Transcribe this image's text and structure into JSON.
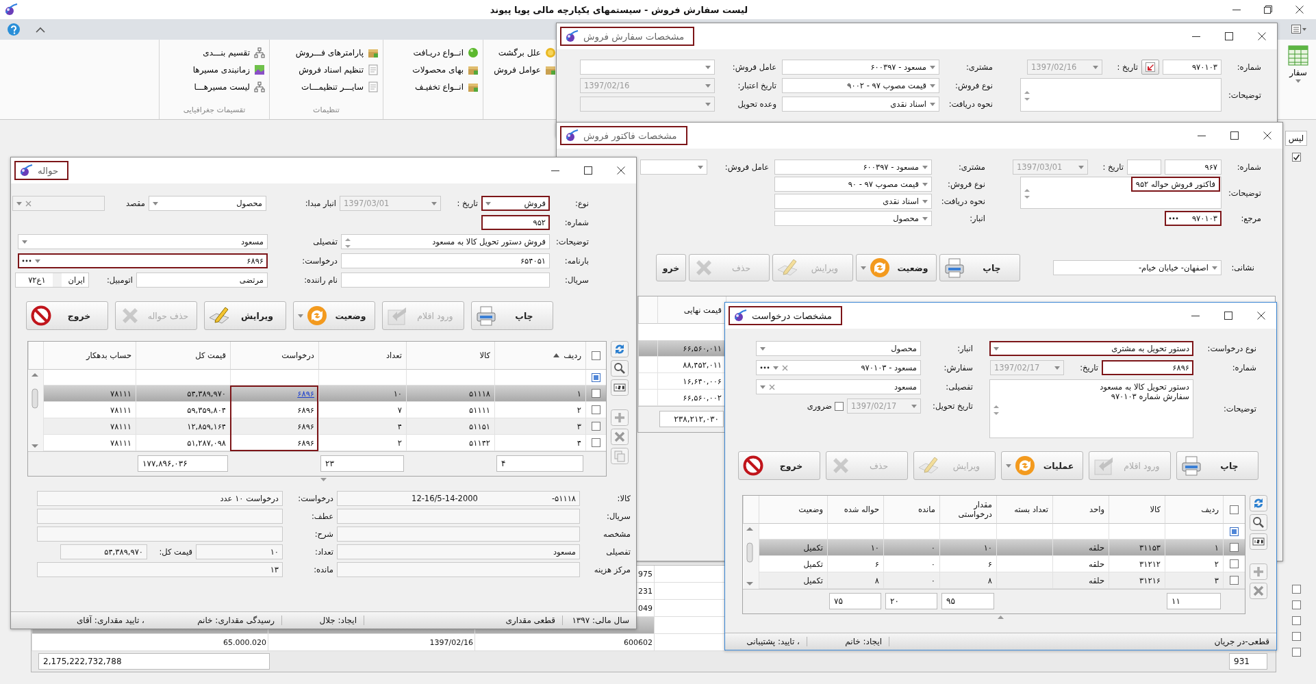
{
  "main": {
    "title": "لیست سفارش فروش - سیستمهای یکپارچه مالی پویا پیوند",
    "ribbon_button": "سفار",
    "ribbon_groups": [
      {
        "items": [
          {
            "label": "علل برگشت"
          },
          {
            "label": "عوامل فروش"
          }
        ]
      },
      {
        "items": [
          {
            "label": "انــواع دریـافت"
          },
          {
            "label": "بهای محصولات"
          },
          {
            "label": "انــواع تخفیـف"
          }
        ]
      },
      {
        "caption": "تنظیمات",
        "items": [
          {
            "label": "پارامترهای فـــروش"
          },
          {
            "label": "تنظیم اسناد فروش"
          },
          {
            "label": "سایـــر تنظیمـــات"
          }
        ]
      },
      {
        "caption": "تقسیمات جغرافیایی",
        "items": [
          {
            "label": "تقسیم بنـــدی"
          },
          {
            "label": "زمانبندی مسیرها"
          },
          {
            "label": "لیست مسیرهـــا"
          }
        ]
      }
    ],
    "tabs": [
      {
        "label": "لیس",
        "selected": true
      }
    ],
    "checks": [
      {
        "checked": true
      },
      {
        "checked": false
      },
      {
        "checked": false
      },
      {
        "checked": false
      },
      {
        "checked": false
      },
      {
        "checked": false
      }
    ],
    "list": {
      "rows": [
        {
          "selected": false,
          "cells": [
            "975",
            null,
            null
          ]
        },
        {
          "selected": false,
          "cells": [
            "231",
            null,
            null
          ]
        },
        {
          "selected": false,
          "cells": [
            "049",
            null,
            null
          ]
        },
        {
          "selected": true,
          "cells": [
            null,
            null,
            null
          ]
        },
        {
          "selected": false,
          "cells": [
            "600602",
            "1397/02/16",
            "65.000.020"
          ]
        }
      ],
      "total": "2,175,222,732,788",
      "count": "931"
    }
  },
  "order": {
    "title": "مشخصات سفارش فروش",
    "title_highlighted": true,
    "form_columns": [
      [
        [
          {
            "label": "شماره:",
            "value": "۹۷۰۱۰۳",
            "kind": "text",
            "disabled": false
          },
          {
            "kind": "button"
          },
          {
            "label": "تاریخ :",
            "value": "1397/02/16",
            "kind": "date",
            "disabled": true
          }
        ],
        [
          {
            "label": "توضیحات:",
            "kind": "memo",
            "disabled": false
          }
        ]
      ],
      [
        [
          {
            "label": "مشتری:",
            "value": "مسعود - ۶۰۰۳۹۷",
            "kind": "combo",
            "disabled": false
          }
        ],
        [
          {
            "label": "نوع فروش:",
            "value": "قیمت مصوب ۹۷ - ۹۰۰۲",
            "kind": "combo",
            "disabled": false
          }
        ],
        [
          {
            "label": "نحوه دریافت:",
            "value": "اسناد نقدی",
            "kind": "combo",
            "disabled": false
          }
        ]
      ],
      [
        [
          {
            "label": "عامل فروش:",
            "kind": "combo",
            "disabled": false
          }
        ],
        [
          {
            "label": "تاریخ اعتبار:",
            "value": "1397/02/16",
            "kind": "date",
            "disabled": true
          }
        ],
        [
          {
            "label": "وعده تحویل",
            "kind": "combo",
            "disabled": true
          }
        ]
      ]
    ]
  },
  "invoice": {
    "title": "مشخصات فاکتور فروش",
    "title_highlighted": true,
    "form_columns": [
      [
        [
          {
            "label": "شماره:",
            "value": "۹۶۷",
            "kind": "text",
            "disabled": false
          },
          {
            "kind": "text",
            "disabled": false
          },
          {
            "label": "تاریخ :",
            "value": "1397/03/01",
            "kind": "date",
            "disabled": true
          }
        ],
        [
          {
            "label": "توضیحات:",
            "value": "فاکتور فروش حواله ۹۵۲",
            "kind": "memo",
            "highlighted": true,
            "disabled": false
          }
        ],
        [
          {
            "label": "مرجع:",
            "value": "۹۷۰۱۰۳",
            "kind": "text",
            "lookup": true,
            "highlighted": true,
            "disabled": false
          }
        ]
      ],
      [
        [
          {
            "label": "مشتری:",
            "value": "مسعود - ۶۰۰۳۹۷",
            "kind": "combo",
            "disabled": false
          }
        ],
        [
          {
            "label": "نوع فروش:",
            "value": "قیمت مصوب ۹۷ - ۹۰",
            "kind": "combo",
            "disabled": false
          }
        ],
        [
          {
            "label": "نحوه دریافت:",
            "value": "اسناد نقدی",
            "kind": "combo",
            "disabled": false
          }
        ],
        [
          {
            "label": "انبار:",
            "value": "محصول",
            "kind": "combo",
            "disabled": false
          }
        ]
      ],
      [
        [
          {
            "label": "عامل فروش:",
            "kind": "combo",
            "disabled": false
          }
        ]
      ]
    ],
    "address": {
      "label": "نشانی:",
      "value": "اصفهان- خیابان خیام-",
      "kind": "combo",
      "disabled": false
    },
    "buttons": [
      {
        "label": "چاپ",
        "kind": "print",
        "disabled": false
      },
      {
        "label": "وضعیت",
        "kind": "status",
        "menu": true,
        "disabled": false
      },
      {
        "label": "ویرایش",
        "kind": "edit",
        "disabled": true
      },
      {
        "label": "حذف",
        "kind": "delete",
        "disabled": true
      },
      {
        "label": "خرو",
        "kind": "exit",
        "disabled": false
      }
    ],
    "grid": {
      "columns": [
        {
          "label": "قیمت نهایی"
        }
      ],
      "totals": [
        "۲۳۸,۲۱۲,۰۳۰"
      ],
      "rows": [
        {
          "selected": true,
          "cells": [
            "۶۶,۵۶۰,۰۱۱"
          ]
        },
        {
          "selected": false,
          "cells": [
            "۸۸,۴۵۲,۰۱۱"
          ]
        },
        {
          "selected": false,
          "cells": [
            "۱۶,۶۴۰,۰۰۶"
          ]
        },
        {
          "selected": false,
          "cells": [
            "۶۶,۵۶۰,۰۰۲"
          ]
        }
      ]
    }
  },
  "transfer": {
    "title": "حواله",
    "title_highlighted": true,
    "form_rows": [
      [
        {
          "label": "نوع:",
          "value": "فروش",
          "kind": "combo",
          "highlighted": true,
          "disabled": false
        },
        {
          "label": "تاریخ :",
          "value": "1397/03/01",
          "kind": "date",
          "disabled": true
        },
        {
          "label": "انبار مبدا:",
          "value": "محصول",
          "kind": "combo",
          "disabled": false
        },
        {
          "label": "مقصد",
          "kind": "combo-clear",
          "disabled": true
        }
      ],
      [
        {
          "label": "شماره:",
          "value": "۹۵۲",
          "kind": "text",
          "highlighted": true,
          "disabled": false
        }
      ],
      [
        {
          "label": "توضیحات:",
          "value": "فروش دستور تحویل کالا به مسعود",
          "kind": "memo",
          "disabled": false
        },
        {
          "label": "تفصیلی",
          "value": "مسعود",
          "kind": "combo",
          "disabled": false
        }
      ],
      [
        {
          "label": "بارنامه:",
          "value": "۶۵۴۰۵۱",
          "kind": "text",
          "disabled": false
        },
        {
          "label": "درخواست:",
          "value": "۶۸۹۶",
          "kind": "combo",
          "lookup": true,
          "highlighted": true,
          "disabled": false
        }
      ],
      [
        {
          "label": "سریال:",
          "kind": "text",
          "disabled": false
        },
        {
          "label": "نام راننده:",
          "value": "مرتضی",
          "kind": "text",
          "disabled": false
        },
        {
          "label": "اتومبیل:",
          "kind": "plate",
          "region": "ایران",
          "value": "۱ع۷۲",
          "disabled": false
        }
      ]
    ],
    "buttons": [
      {
        "label": "چاپ",
        "kind": "print",
        "disabled": false
      },
      {
        "label": "ورود اقلام",
        "kind": "import",
        "disabled": true
      },
      {
        "label": "وضعیت",
        "kind": "status",
        "menu": true,
        "disabled": false
      },
      {
        "label": "ویرایش",
        "kind": "edit",
        "disabled": false
      },
      {
        "label": "حذف حواله",
        "kind": "delete",
        "disabled": true
      },
      {
        "label": "خروج",
        "kind": "exit",
        "disabled": false
      }
    ],
    "grid": {
      "header_checked": false,
      "columns": [
        {
          "label": "ردیف",
          "sorted": true,
          "highlighted": false
        },
        {
          "label": "کالا",
          "highlighted": false
        },
        {
          "label": "تعداد",
          "highlighted": false
        },
        {
          "label": "درخواست",
          "kind": "link",
          "highlighted": true
        },
        {
          "label": "قیمت کل",
          "highlighted": false
        },
        {
          "label": "حساب بدهکار",
          "highlighted": false
        }
      ],
      "totals": [
        "۴",
        "۲۳",
        "۱۷۷,۸۹۶,۰۳۶"
      ],
      "rows": [
        {
          "selected": true,
          "checked": false,
          "cells": [
            "۱",
            "۵۱۱۱۸",
            "۱۰",
            "۶۸۹۶",
            "۵۴,۳۸۹,۹۷۰",
            "۷۸۱۱۱"
          ]
        },
        {
          "selected": false,
          "checked": false,
          "cells": [
            "۲",
            "۵۱۱۱۱",
            "۷",
            "۶۸۹۶",
            "۵۹,۳۵۹,۸۰۴",
            "۷۸۱۱۱"
          ]
        },
        {
          "selected": false,
          "checked": false,
          "cells": [
            "۳",
            "۵۱۱۵۱",
            "۴",
            "۶۸۹۶",
            "۱۲,۸۵۹,۱۶۴",
            "۷۸۱۱۱"
          ]
        },
        {
          "selected": false,
          "checked": false,
          "cells": [
            "۴",
            "۵۱۱۴۲",
            "۲",
            "۶۸۹۶",
            "۵۱,۲۸۷,۰۹۸",
            "۷۸۱۱۱"
          ]
        }
      ]
    },
    "detail_rows": [
      [
        {
          "label": "کالا:",
          "value": "۵۱۱۱۸-",
          "description": "12-16/5-14-2000",
          "kind": "text"
        },
        {
          "label": "درخواست:",
          "value": "درخواست ۱۰ عدد",
          "kind": "text"
        }
      ],
      [
        {
          "label": "سریال:",
          "kind": "text"
        },
        {
          "label": "عطف:",
          "kind": "text"
        }
      ],
      [
        {
          "label": "مشخصه",
          "kind": "text"
        },
        {
          "label": "شرح:",
          "kind": "text"
        }
      ],
      [
        {
          "label": "تفصیلی",
          "value": "مسعود",
          "kind": "text"
        },
        {
          "label": "تعداد:",
          "value": "۱۰",
          "kind": "text"
        },
        {
          "label": "قیمت کل:",
          "value": "۵۴,۳۸۹,۹۷۰",
          "kind": "text"
        }
      ],
      [
        {
          "label": "مرکز هزینه",
          "kind": "text"
        },
        {
          "label": "مانده:",
          "value": "۱۳",
          "kind": "text"
        }
      ]
    ],
    "status": [
      "سال مالی: ۱۳۹۷",
      "قطعی مقداری",
      "ایجاد: جلال",
      "رسیدگی مقداری: خانم",
      "، تایید مقداری: آقای"
    ]
  },
  "request": {
    "title": "مشخصات درخواست",
    "title_highlighted": true,
    "form_columns": [
      [
        [
          {
            "label": "نوع درخواست:",
            "value": "دستور تحویل به مشتری",
            "kind": "combo",
            "highlighted": true,
            "disabled": false
          }
        ],
        [
          {
            "label": "شماره:",
            "value": "۶۸۹۶",
            "kind": "text",
            "highlighted": true,
            "disabled": false
          },
          {
            "label": "تاریخ:",
            "value": "1397/02/17",
            "kind": "date",
            "disabled": true
          }
        ],
        [
          {
            "label": "توضیحات:",
            "lines": [
              "دستور تحویل کالا به مسعود",
              "سفارش شماره ۹۷۰۱۰۳"
            ],
            "kind": "memo",
            "disabled": false
          }
        ]
      ],
      [
        [
          {
            "label": "انبار:",
            "value": "محصول",
            "kind": "combo",
            "disabled": false
          }
        ],
        [
          {
            "label": "سفارش:",
            "value": "مسعود - ۹۷۰۱۰۳",
            "kind": "combo-clear",
            "lookup": true,
            "disabled": false
          }
        ],
        [
          {
            "label": "تفصیلی:",
            "value": "مسعود",
            "kind": "combo-clear",
            "disabled": false
          }
        ],
        [
          {
            "label": "تاریخ تحویل:",
            "value": "1397/02/17",
            "kind": "date",
            "disabled": true
          },
          {
            "label": "ضروری",
            "kind": "checkbox",
            "checked": false
          }
        ]
      ]
    ],
    "buttons": [
      {
        "label": "چاپ",
        "kind": "print",
        "disabled": false
      },
      {
        "label": "ورود اقلام",
        "kind": "import",
        "disabled": true
      },
      {
        "label": "عملیات",
        "kind": "status",
        "menu": true,
        "disabled": false
      },
      {
        "label": "ویرایش",
        "kind": "edit",
        "disabled": true
      },
      {
        "label": "حذف",
        "kind": "delete",
        "disabled": true
      },
      {
        "label": "خروج",
        "kind": "exit",
        "disabled": false
      }
    ],
    "grid": {
      "header_checked": false,
      "columns": [
        {
          "label": "ردیف",
          "highlighted": false
        },
        {
          "label": "کالا",
          "highlighted": false
        },
        {
          "label": "واحد",
          "highlighted": false
        },
        {
          "label": "تعداد بسته",
          "highlighted": false
        },
        {
          "label": "مقدار درخواستی",
          "highlighted": false
        },
        {
          "label": "مانده",
          "highlighted": false
        },
        {
          "label": "حواله شده",
          "highlighted": false
        },
        {
          "label": "وضعیت",
          "highlighted": false
        }
      ],
      "totals": [
        "۱۱",
        "۹۵",
        "۲۰",
        "۷۵"
      ],
      "rows": [
        {
          "selected": true,
          "checked": false,
          "cells": [
            "۱",
            "۳۱۱۵۳",
            "حلقه",
            null,
            "۱۰",
            "۰",
            "۱۰",
            "تکمیل"
          ]
        },
        {
          "selected": false,
          "checked": false,
          "cells": [
            "۲",
            "۳۱۲۱۲",
            "حلقه",
            null,
            "۶",
            "۰",
            "۶",
            "تکمیل"
          ]
        },
        {
          "selected": false,
          "checked": false,
          "cells": [
            "۳",
            "۳۱۲۱۶",
            "حلقه",
            null,
            "۸",
            "۰",
            "۸",
            "تکمیل"
          ]
        }
      ]
    },
    "status": [
      "قطعی-در جریان",
      "ایجاد: خانم",
      "، تایید: پشتیبانی"
    ]
  }
}
